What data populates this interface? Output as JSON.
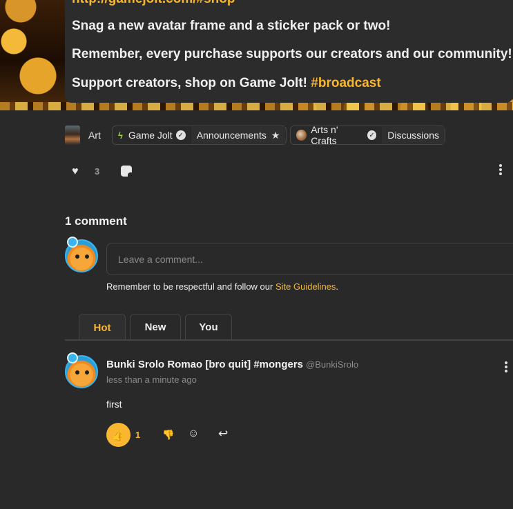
{
  "post": {
    "cut_top_link": "http://gamejolt.com/#shop",
    "line1": "Snag a new avatar frame and a sticker pack or two!",
    "line2": "Remember, every purchase supports our creators and our community!",
    "line3_text": "Support creators, shop on Game Jolt! ",
    "line3_hashtag": "#broadcast"
  },
  "communities": {
    "art_label": "Art",
    "gamejolt": {
      "name": "Game Jolt",
      "channel": "Announcements"
    },
    "artsncrafts": {
      "name": "Arts n' Crafts",
      "channel": "Discussions"
    }
  },
  "post_actions": {
    "like_count": "3",
    "icons": [
      "heart-icon",
      "sticker-icon",
      "more-vertical-icon"
    ]
  },
  "comments": {
    "title": "1 comment",
    "input_placeholder": "Leave a comment...",
    "guidelines_prefix": "Remember to be respectful and follow our ",
    "guidelines_link": "Site Guidelines",
    "guidelines_suffix": ".",
    "tabs": [
      {
        "label": "Hot",
        "active": true
      },
      {
        "label": "New",
        "active": false
      },
      {
        "label": "You",
        "active": false
      }
    ],
    "items": [
      {
        "author": "Bunki Srolo Romao [bro quit] #mongers",
        "handle": "@BunkiSrolo",
        "time": "less than a minute ago",
        "body": "first",
        "votes": "1"
      }
    ]
  },
  "colors": {
    "accent": "#f9b731",
    "background": "#292929",
    "muted_text": "#8a8a8a"
  }
}
